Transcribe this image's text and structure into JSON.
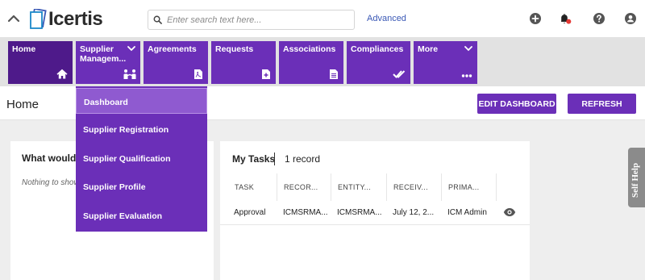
{
  "header": {
    "logo_text": "Icertis",
    "search_placeholder": "Enter search text here...",
    "advanced_label": "Advanced"
  },
  "modules": [
    {
      "label_line1": "Home",
      "label_line2": "",
      "icon": "home-icon"
    },
    {
      "label_line1": "Supplier",
      "label_line2": "Managem...",
      "icon": "supplier-people-icon"
    },
    {
      "label_line1": "Agreements",
      "label_line2": "",
      "icon": "pdf-document-icon"
    },
    {
      "label_line1": "Requests",
      "label_line2": "",
      "icon": "add-document-icon"
    },
    {
      "label_line1": "Associations",
      "label_line2": "",
      "icon": "document-icon"
    },
    {
      "label_line1": "Compliances",
      "label_line2": "",
      "icon": "double-check-icon"
    },
    {
      "label_line1": "More",
      "label_line2": "",
      "icon": "more-dots-icon"
    }
  ],
  "page": {
    "title": "Home",
    "edit_dashboard_label": "EDIT DASHBOARD",
    "refresh_label": "REFRESH"
  },
  "dropdown": {
    "items": [
      {
        "label": "Dashboard"
      },
      {
        "label": "Supplier Registration"
      },
      {
        "label": "Supplier Qualification"
      },
      {
        "label": "Supplier Profile"
      },
      {
        "label": "Supplier Evaluation"
      }
    ]
  },
  "left_card": {
    "title": "What would y",
    "empty_text": "Nothing to show"
  },
  "tasks": {
    "title": "My Tasks",
    "count": "1 record",
    "columns": [
      "TASK",
      "RECOR...",
      "ENTITY...",
      "RECEIV...",
      "PRIMA..."
    ],
    "rows": [
      [
        "Approval",
        "ICMSRMA...",
        "ICMSRMA...",
        "July 12, 2...",
        "ICM Admin"
      ]
    ]
  },
  "self_help_label": "Self Help",
  "colors": {
    "brand_purple": "#6b2fb8",
    "active_tile": "#4e1a8a",
    "dropdown_highlight": "#8f5ad0",
    "notification_dot": "#e53935",
    "link_blue": "#3a58b5"
  }
}
